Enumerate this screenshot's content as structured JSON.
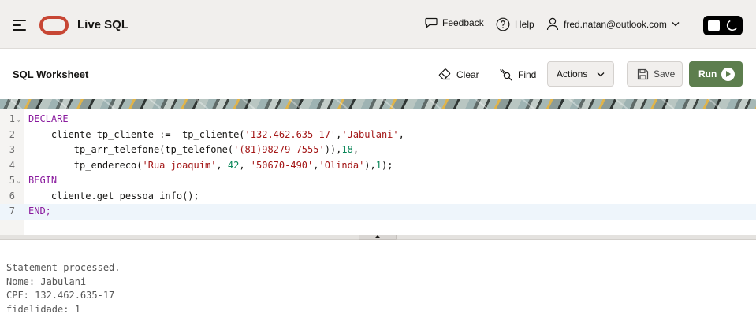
{
  "topbar": {
    "app_title": "Live SQL",
    "feedback_label": "Feedback",
    "help_label": "Help",
    "user_email": "fred.natan@outlook.com",
    "brand_color": "#c74634"
  },
  "worksheet": {
    "title": "SQL Worksheet",
    "clear_label": "Clear",
    "find_label": "Find",
    "actions_label": "Actions",
    "save_label": "Save",
    "run_label": "Run",
    "run_color": "#5d7e4e"
  },
  "editor": {
    "lines": [
      {
        "number": "1",
        "foldable": true
      },
      {
        "number": "2",
        "foldable": false
      },
      {
        "number": "3",
        "foldable": false
      },
      {
        "number": "4",
        "foldable": false
      },
      {
        "number": "5",
        "foldable": true
      },
      {
        "number": "6",
        "foldable": false
      },
      {
        "number": "7",
        "foldable": false
      }
    ],
    "code_text": [
      "DECLARE",
      "    cliente tp_cliente :=  tp_cliente('132.462.635-17','Jabulani',",
      "        tp_arr_telefone(tp_telefone('(81)98279-7555')),18,",
      "        tp_endereco('Rua joaquim', 42, '50670-490','Olinda'),1);",
      "BEGIN",
      "    cliente.get_pessoa_info();",
      "END;"
    ],
    "active_line": 7
  },
  "output": {
    "lines": [
      "Statement processed.",
      "Nome: Jabulani",
      "CPF: 132.462.635-17",
      "fidelidade: 1"
    ]
  }
}
